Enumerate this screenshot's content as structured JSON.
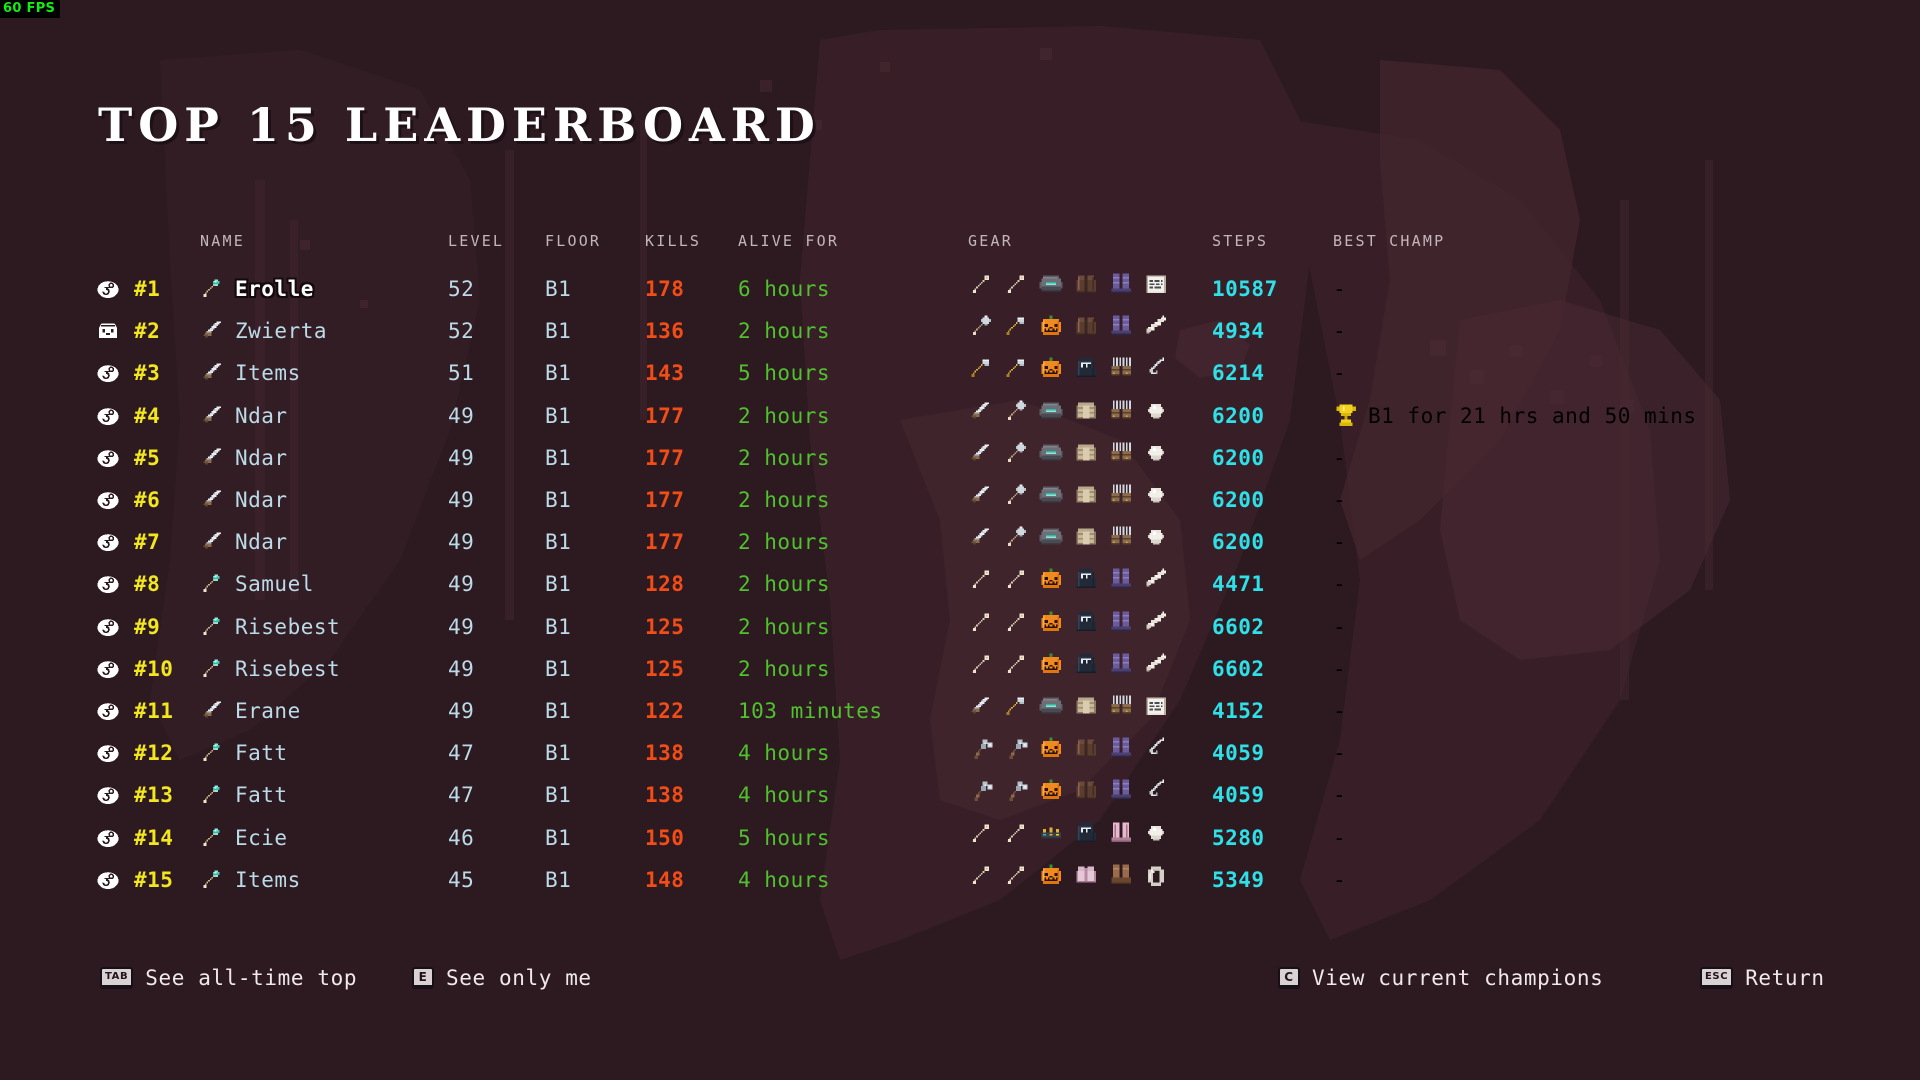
{
  "hud": {
    "fps": "60 FPS"
  },
  "page": {
    "title": "TOP 15 LEADERBOARD"
  },
  "table": {
    "headers": {
      "name": "NAME",
      "level": "LEVEL",
      "floor": "FLOOR",
      "kills": "KILLS",
      "alive": "ALIVE FOR",
      "gear": "GEAR",
      "steps": "STEPS",
      "champ": "BEST CHAMP"
    },
    "rows": [
      {
        "platform": "steam",
        "rank": "#1",
        "class": "staff",
        "name": "Erolle",
        "highlight": true,
        "level": "52",
        "floor": "B1",
        "kills": "178",
        "alive": "6 hours",
        "gear": [
          "wand",
          "wand",
          "helmet-gray",
          "armor-brown",
          "boots-purple",
          "book"
        ],
        "steps": "10587",
        "champ": "-",
        "champ_has": false
      },
      {
        "platform": "itch",
        "rank": "#2",
        "class": "sword",
        "name": "Zwierta",
        "highlight": false,
        "level": "52",
        "floor": "B1",
        "kills": "136",
        "alive": "2 hours",
        "gear": [
          "mace",
          "axe",
          "pumpkin",
          "armor-brown",
          "boots-purple",
          "feather"
        ],
        "steps": "4934",
        "champ": "-",
        "champ_has": false
      },
      {
        "platform": "steam",
        "rank": "#3",
        "class": "sword",
        "name": "Items",
        "highlight": false,
        "level": "51",
        "floor": "B1",
        "kills": "143",
        "alive": "5 hours",
        "gear": [
          "axe",
          "axe",
          "pumpkin",
          "hood-dark",
          "gauntlets",
          "hook"
        ],
        "steps": "6214",
        "champ": "-",
        "champ_has": false
      },
      {
        "platform": "steam",
        "rank": "#4",
        "class": "sword",
        "name": "Ndar",
        "highlight": false,
        "level": "49",
        "floor": "B1",
        "kills": "177",
        "alive": "2 hours",
        "gear": [
          "sword",
          "mace",
          "helmet-gray",
          "armor-tan",
          "gauntlets",
          "orb"
        ],
        "steps": "6200",
        "champ": "B1 for 21 hrs and 50 mins",
        "champ_has": true
      },
      {
        "platform": "steam",
        "rank": "#5",
        "class": "sword",
        "name": "Ndar",
        "highlight": false,
        "level": "49",
        "floor": "B1",
        "kills": "177",
        "alive": "2 hours",
        "gear": [
          "sword",
          "mace",
          "helmet-gray",
          "armor-tan",
          "gauntlets",
          "orb"
        ],
        "steps": "6200",
        "champ": "-",
        "champ_has": false
      },
      {
        "platform": "steam",
        "rank": "#6",
        "class": "sword",
        "name": "Ndar",
        "highlight": false,
        "level": "49",
        "floor": "B1",
        "kills": "177",
        "alive": "2 hours",
        "gear": [
          "sword",
          "mace",
          "helmet-gray",
          "armor-tan",
          "gauntlets",
          "orb"
        ],
        "steps": "6200",
        "champ": "-",
        "champ_has": false
      },
      {
        "platform": "steam",
        "rank": "#7",
        "class": "sword",
        "name": "Ndar",
        "highlight": false,
        "level": "49",
        "floor": "B1",
        "kills": "177",
        "alive": "2 hours",
        "gear": [
          "sword",
          "mace",
          "helmet-gray",
          "armor-tan",
          "gauntlets",
          "orb"
        ],
        "steps": "6200",
        "champ": "-",
        "champ_has": false
      },
      {
        "platform": "steam",
        "rank": "#8",
        "class": "staff",
        "name": "Samuel",
        "highlight": false,
        "level": "49",
        "floor": "B1",
        "kills": "128",
        "alive": "2 hours",
        "gear": [
          "wand",
          "wand",
          "pumpkin",
          "hood-dark",
          "boots-purple",
          "feather"
        ],
        "steps": "4471",
        "champ": "-",
        "champ_has": false
      },
      {
        "platform": "steam",
        "rank": "#9",
        "class": "staff",
        "name": "Risebest",
        "highlight": false,
        "level": "49",
        "floor": "B1",
        "kills": "125",
        "alive": "2 hours",
        "gear": [
          "wand",
          "wand",
          "pumpkin",
          "hood-dark",
          "boots-purple",
          "feather"
        ],
        "steps": "6602",
        "champ": "-",
        "champ_has": false
      },
      {
        "platform": "steam",
        "rank": "#10",
        "class": "staff",
        "name": "Risebest",
        "highlight": false,
        "level": "49",
        "floor": "B1",
        "kills": "125",
        "alive": "2 hours",
        "gear": [
          "wand",
          "wand",
          "pumpkin",
          "hood-dark",
          "boots-purple",
          "feather"
        ],
        "steps": "6602",
        "champ": "-",
        "champ_has": false
      },
      {
        "platform": "steam",
        "rank": "#11",
        "class": "sword",
        "name": "Erane",
        "highlight": false,
        "level": "49",
        "floor": "B1",
        "kills": "122",
        "alive": "103 minutes",
        "gear": [
          "sword",
          "axe",
          "helmet-gray",
          "armor-tan",
          "gauntlets",
          "book"
        ],
        "steps": "4152",
        "champ": "-",
        "champ_has": false
      },
      {
        "platform": "steam",
        "rank": "#12",
        "class": "staff",
        "name": "Fatt",
        "highlight": false,
        "level": "47",
        "floor": "B1",
        "kills": "138",
        "alive": "4 hours",
        "gear": [
          "flail",
          "flail",
          "pumpkin",
          "armor-brown",
          "boots-purple",
          "hook"
        ],
        "steps": "4059",
        "champ": "-",
        "champ_has": false
      },
      {
        "platform": "steam",
        "rank": "#13",
        "class": "staff",
        "name": "Fatt",
        "highlight": false,
        "level": "47",
        "floor": "B1",
        "kills": "138",
        "alive": "4 hours",
        "gear": [
          "flail",
          "flail",
          "pumpkin",
          "armor-brown",
          "boots-purple",
          "hook"
        ],
        "steps": "4059",
        "champ": "-",
        "champ_has": false
      },
      {
        "platform": "steam",
        "rank": "#14",
        "class": "staff",
        "name": "Ecie",
        "highlight": false,
        "level": "46",
        "floor": "B1",
        "kills": "150",
        "alive": "5 hours",
        "gear": [
          "wand",
          "wand",
          "crown",
          "hood-dark",
          "boots-pink",
          "orb"
        ],
        "steps": "5280",
        "champ": "-",
        "champ_has": false
      },
      {
        "platform": "steam",
        "rank": "#15",
        "class": "staff",
        "name": "Items",
        "highlight": false,
        "level": "45",
        "floor": "B1",
        "kills": "148",
        "alive": "4 hours",
        "gear": [
          "wand",
          "wand",
          "pumpkin",
          "armor-pink",
          "boots-brown",
          "ring"
        ],
        "steps": "5349",
        "champ": "-",
        "champ_has": false
      }
    ]
  },
  "footer": {
    "items": [
      {
        "key": "TAB",
        "wide": true,
        "label": "See all-time top"
      },
      {
        "key": "E",
        "wide": false,
        "label": "See only me"
      },
      {
        "key": "C",
        "wide": false,
        "label": "View current champions"
      },
      {
        "key": "ESC",
        "wide": true,
        "label": "Return"
      }
    ]
  },
  "colors": {
    "background": "#2d1a21",
    "rank": "#f2e61e",
    "name": "#bcdbe8",
    "kills": "#f24d16",
    "alive": "#4fc22e",
    "steps": "#2fe0e8",
    "champ": "#f2d21e",
    "fps": "#12ee12"
  }
}
